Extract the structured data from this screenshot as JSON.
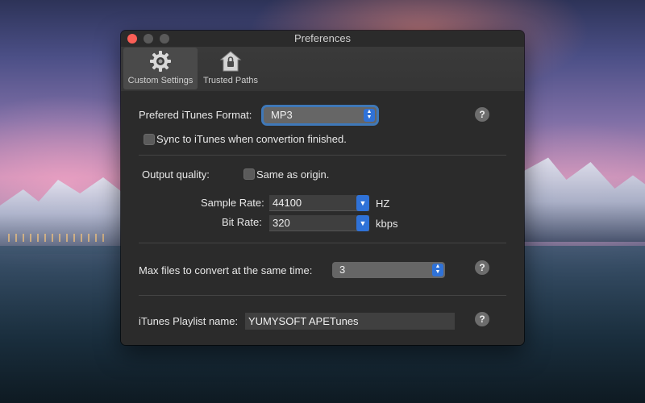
{
  "window": {
    "title": "Preferences"
  },
  "toolbar": {
    "tabs": [
      {
        "label": "Custom Settings",
        "icon": "gear-icon"
      },
      {
        "label": "Trusted Paths",
        "icon": "house-lock-icon"
      }
    ],
    "active_tab": "Custom Settings"
  },
  "itunes_format": {
    "label": "Prefered iTunes Format:",
    "value": "MP3",
    "help": "?"
  },
  "sync": {
    "label": "Sync to iTunes when convertion finished.",
    "checked": false
  },
  "output_quality": {
    "label": "Output quality:",
    "same_as_origin_label": "Same as origin.",
    "same_as_origin_checked": false,
    "sample_rate_label": "Sample Rate:",
    "sample_rate_value": "44100",
    "sample_rate_unit": "HZ",
    "bit_rate_label": "Bit Rate:",
    "bit_rate_value": "320",
    "bit_rate_unit": "kbps"
  },
  "max_files": {
    "label": "Max files to convert at the same time:",
    "value": "3",
    "help": "?"
  },
  "playlist": {
    "label": "iTunes Playlist name:",
    "value": "YUMYSOFT APETunes",
    "help": "?"
  },
  "colors": {
    "accent": "#2f72d8",
    "close_button": "#fc5f57",
    "window_bg": "#2b2b2b"
  }
}
